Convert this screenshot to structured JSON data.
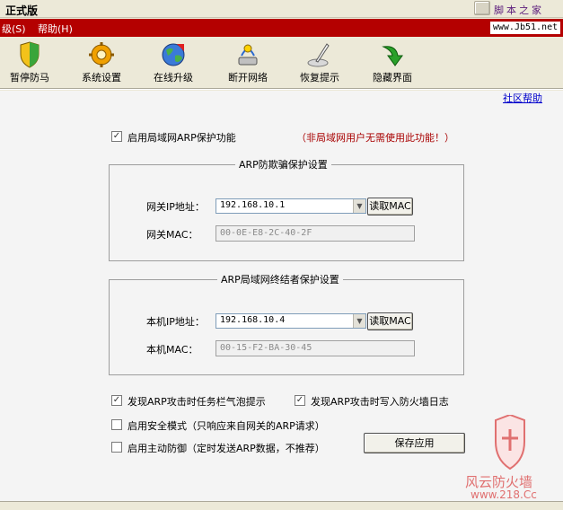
{
  "window": {
    "title": "正式版",
    "watermark_text": "脚本之家"
  },
  "menubar": {
    "items": [
      "级(S)",
      "帮助(H)"
    ],
    "site_badge": "www.Jb51.net"
  },
  "toolbar": {
    "items": [
      {
        "label": "暂停防马",
        "icon": "shield-icon"
      },
      {
        "label": "系统设置",
        "icon": "gear-icon"
      },
      {
        "label": "在线升级",
        "icon": "globe-icon"
      },
      {
        "label": "断开网络",
        "icon": "network-icon"
      },
      {
        "label": "恢复提示",
        "icon": "feather-ink-icon"
      },
      {
        "label": "隐藏界面",
        "icon": "green-arrow-icon"
      }
    ]
  },
  "links": {
    "help": "社区帮助"
  },
  "arp_enable": {
    "label": "启用局域网ARP保护功能",
    "checked": true,
    "note": "（非局域网用户无需使用此功能！）"
  },
  "gateway_group": {
    "title": "ARP防欺骗保护设置",
    "ip_label": "网关IP地址：",
    "ip_value": "192.168.10.1",
    "mac_label": "网关MAC：",
    "mac_value": "00-0E-E8-2C-40-2F",
    "get_mac_button": "读取MAC"
  },
  "local_group": {
    "title": "ARP局域网终结者保护设置",
    "ip_label": "本机IP地址：",
    "ip_value": "192.168.10.4",
    "mac_label": "本机MAC：",
    "mac_value": "00-15-F2-BA-30-45",
    "get_mac_button": "读取MAC"
  },
  "options": [
    {
      "label": "发现ARP攻击时任务栏气泡提示",
      "checked": true
    },
    {
      "label": "发现ARP攻击时写入防火墙日志",
      "checked": true
    },
    {
      "label": "启用安全模式（只响应来自网关的ARP请求）",
      "checked": false
    },
    {
      "label": "启用主动防御（定时发送ARP数据，不推荐）",
      "checked": false
    }
  ],
  "save_button": "保存应用",
  "brand_watermark": {
    "name": "风云防火墙",
    "url": "www.218.Cc"
  },
  "colors": {
    "menubar_bg": "#b40000",
    "note_red": "#a80000",
    "link_blue": "#0000cc"
  }
}
